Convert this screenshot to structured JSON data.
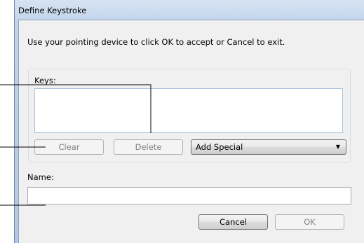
{
  "window": {
    "title": "Define Keystroke"
  },
  "instructions": "Use your pointing device to click OK to accept or Cancel to exit.",
  "keys": {
    "label": "Keys:",
    "value": "",
    "clear_label": "Clear",
    "delete_label": "Delete",
    "special_select": {
      "value": "Add Special"
    }
  },
  "name": {
    "label": "Name:",
    "value": ""
  },
  "buttons": {
    "cancel_label": "Cancel",
    "ok_label": "OK"
  }
}
